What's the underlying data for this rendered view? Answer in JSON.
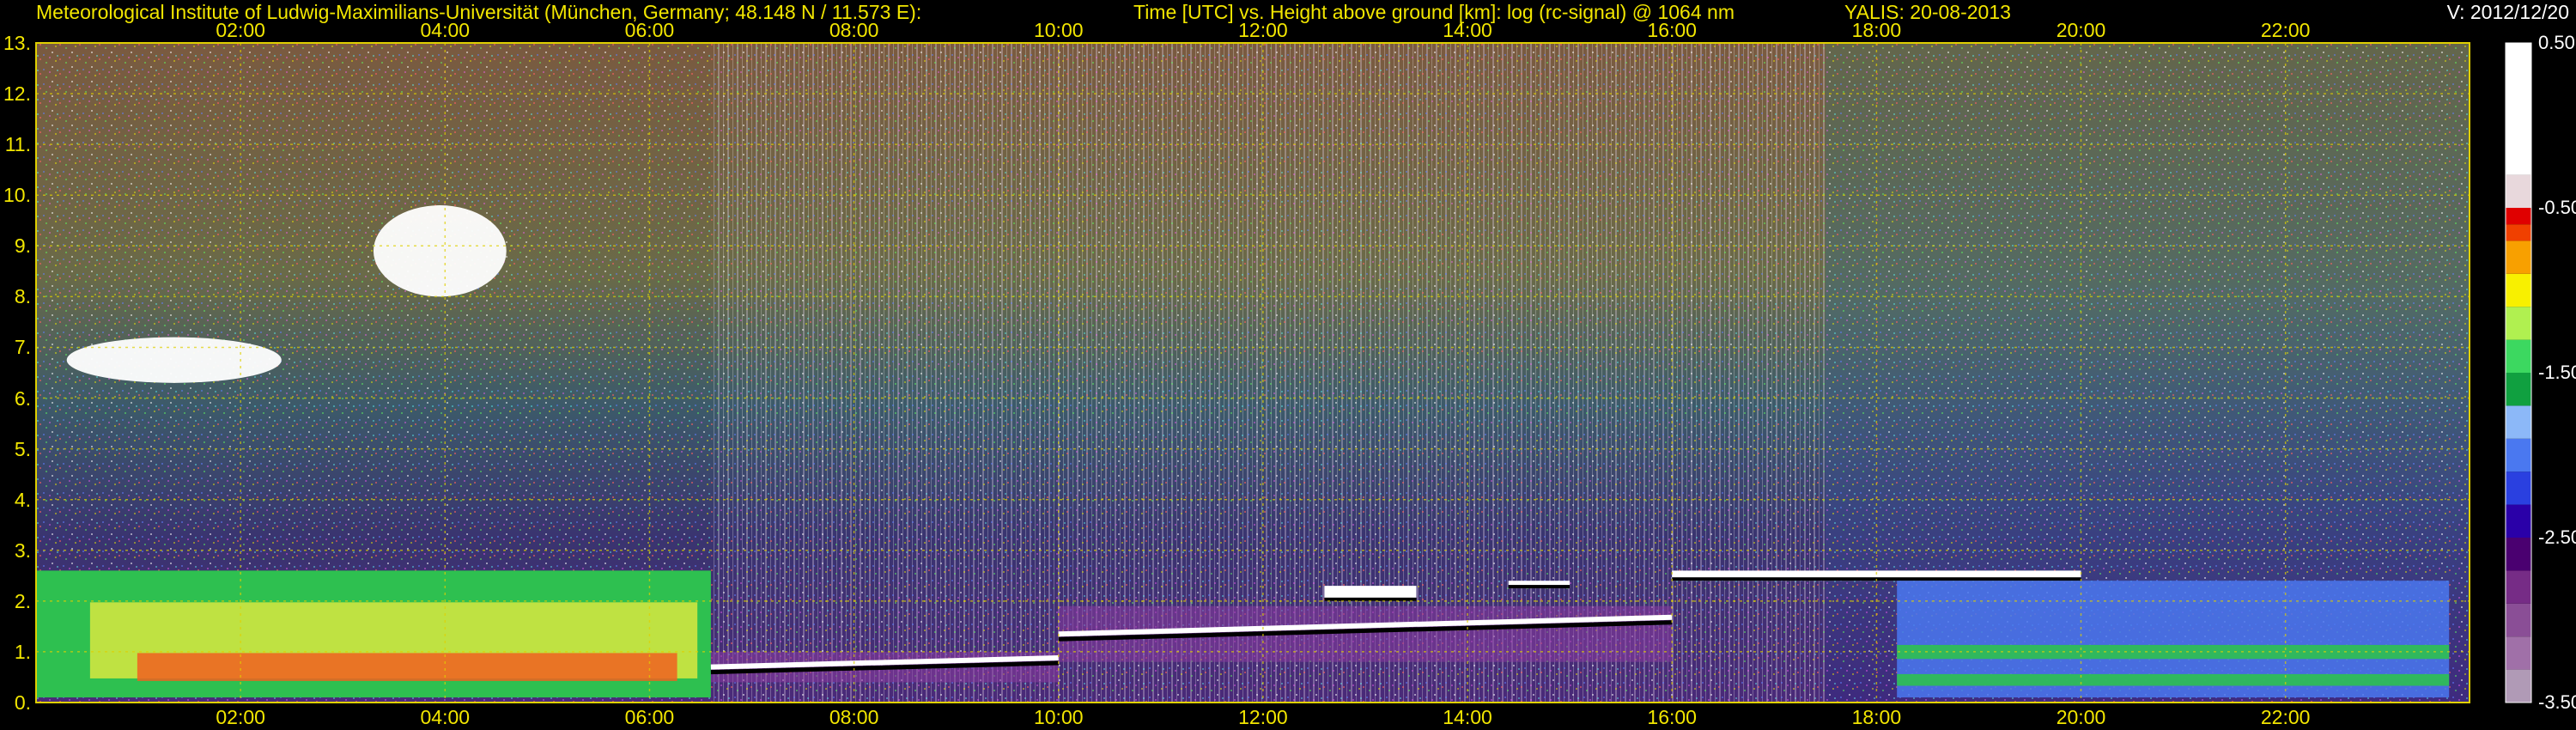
{
  "header": {
    "institute": "Meteorological Institute of Ludwig-Maximilians-Universität (München, Germany; 48.148 N / 11.573 E):",
    "axes_description": "Time [UTC] vs. Height above ground [km]: log (rc-signal) @ 1064 nm",
    "system_date": "YALIS: 20-08-2013",
    "version": "V: 2012/12/20"
  },
  "chart_data": {
    "type": "heatmap",
    "title": "Time [UTC] vs. Height above ground [km]: log (rc-signal) @ 1064 nm",
    "xlabel": "Time [UTC]",
    "ylabel": "Height above ground [km]",
    "x_range_hours": [
      0,
      23.8
    ],
    "ylim": [
      0,
      13
    ],
    "x_ticks": [
      {
        "hour": 2,
        "label": "02:00"
      },
      {
        "hour": 4,
        "label": "04:00"
      },
      {
        "hour": 6,
        "label": "06:00"
      },
      {
        "hour": 8,
        "label": "08:00"
      },
      {
        "hour": 10,
        "label": "10:00"
      },
      {
        "hour": 12,
        "label": "12:00"
      },
      {
        "hour": 14,
        "label": "14:00"
      },
      {
        "hour": 16,
        "label": "16:00"
      },
      {
        "hour": 18,
        "label": "18:00"
      },
      {
        "hour": 20,
        "label": "20:00"
      },
      {
        "hour": 22,
        "label": "22:00"
      }
    ],
    "y_ticks": [
      {
        "value": 0,
        "label": "0."
      },
      {
        "value": 1,
        "label": "1."
      },
      {
        "value": 2,
        "label": "2."
      },
      {
        "value": 3,
        "label": "3."
      },
      {
        "value": 4,
        "label": "4."
      },
      {
        "value": 5,
        "label": "5."
      },
      {
        "value": 6,
        "label": "6."
      },
      {
        "value": 7,
        "label": "7."
      },
      {
        "value": 8,
        "label": "8."
      },
      {
        "value": 9,
        "label": "9."
      },
      {
        "value": 10,
        "label": "10."
      },
      {
        "value": 11,
        "label": "11."
      },
      {
        "value": 12,
        "label": "12."
      },
      {
        "value": 13,
        "label": "13."
      }
    ],
    "grid": true,
    "colorbar": {
      "placement": "right",
      "range": [
        -3.5,
        0.5
      ],
      "ticks": [
        {
          "value": 0.5,
          "label": "0.50"
        },
        {
          "value": -0.5,
          "label": "-0.50"
        },
        {
          "value": -1.5,
          "label": "-1.50"
        },
        {
          "value": -2.5,
          "label": "-2.50"
        },
        {
          "value": -3.5,
          "label": "-3.50"
        }
      ],
      "color_steps": [
        {
          "from": -3.5,
          "to": -3.3,
          "color": "#b09ab6"
        },
        {
          "from": -3.3,
          "to": -3.1,
          "color": "#a070a8"
        },
        {
          "from": -3.1,
          "to": -2.9,
          "color": "#8a4e96"
        },
        {
          "from": -2.9,
          "to": -2.7,
          "color": "#762c86"
        },
        {
          "from": -2.7,
          "to": -2.5,
          "color": "#4a0070"
        },
        {
          "from": -2.5,
          "to": -2.3,
          "color": "#2a00a8"
        },
        {
          "from": -2.3,
          "to": -2.1,
          "color": "#2a40e0"
        },
        {
          "from": -2.1,
          "to": -1.9,
          "color": "#4a78f0"
        },
        {
          "from": -1.9,
          "to": -1.7,
          "color": "#8cb8f8"
        },
        {
          "from": -1.7,
          "to": -1.5,
          "color": "#10a040"
        },
        {
          "from": -1.5,
          "to": -1.3,
          "color": "#3cd860"
        },
        {
          "from": -1.3,
          "to": -1.1,
          "color": "#b0f050"
        },
        {
          "from": -1.1,
          "to": -0.9,
          "color": "#f8f000"
        },
        {
          "from": -0.9,
          "to": -0.7,
          "color": "#f8a000"
        },
        {
          "from": -0.7,
          "to": -0.6,
          "color": "#f04000"
        },
        {
          "from": -0.6,
          "to": -0.5,
          "color": "#e00000"
        },
        {
          "from": -0.5,
          "to": -0.3,
          "color": "#e8d8dc"
        },
        {
          "from": -0.3,
          "to": 0.5,
          "color": "#ffffff"
        }
      ]
    },
    "features": [
      {
        "kind": "boundary_layer_aerosol",
        "x_hours": [
          0.0,
          6.6
        ],
        "y_km": [
          0.1,
          2.6
        ],
        "level": -1.0
      },
      {
        "kind": "cloud",
        "x_hours": [
          0.3,
          2.4
        ],
        "y_km": [
          6.3,
          7.2
        ],
        "level": 0.3
      },
      {
        "kind": "cloud",
        "x_hours": [
          3.3,
          4.6
        ],
        "y_km": [
          8.0,
          9.8
        ],
        "level": 0.2
      },
      {
        "kind": "boundary_layer_top",
        "x_hours": [
          6.6,
          10.0
        ],
        "y_km": [
          0.4,
          1.0
        ],
        "level": 0.3
      },
      {
        "kind": "boundary_layer_top",
        "x_hours": [
          10.0,
          16.0
        ],
        "y_km": [
          0.8,
          1.9
        ],
        "level": 0.3
      },
      {
        "kind": "cloud_layer",
        "x_hours": [
          12.6,
          13.5
        ],
        "y_km": [
          2.0,
          2.3
        ],
        "level": 0.3
      },
      {
        "kind": "cloud_layer",
        "x_hours": [
          14.4,
          15.0
        ],
        "y_km": [
          2.25,
          2.4
        ],
        "level": 0.3
      },
      {
        "kind": "cloud_layer",
        "x_hours": [
          16.0,
          20.0
        ],
        "y_km": [
          2.4,
          2.6
        ],
        "level": 0.4
      },
      {
        "kind": "residual_layer",
        "x_hours": [
          18.2,
          23.6
        ],
        "y_km": [
          0.1,
          2.4
        ],
        "level": -1.9
      }
    ]
  }
}
